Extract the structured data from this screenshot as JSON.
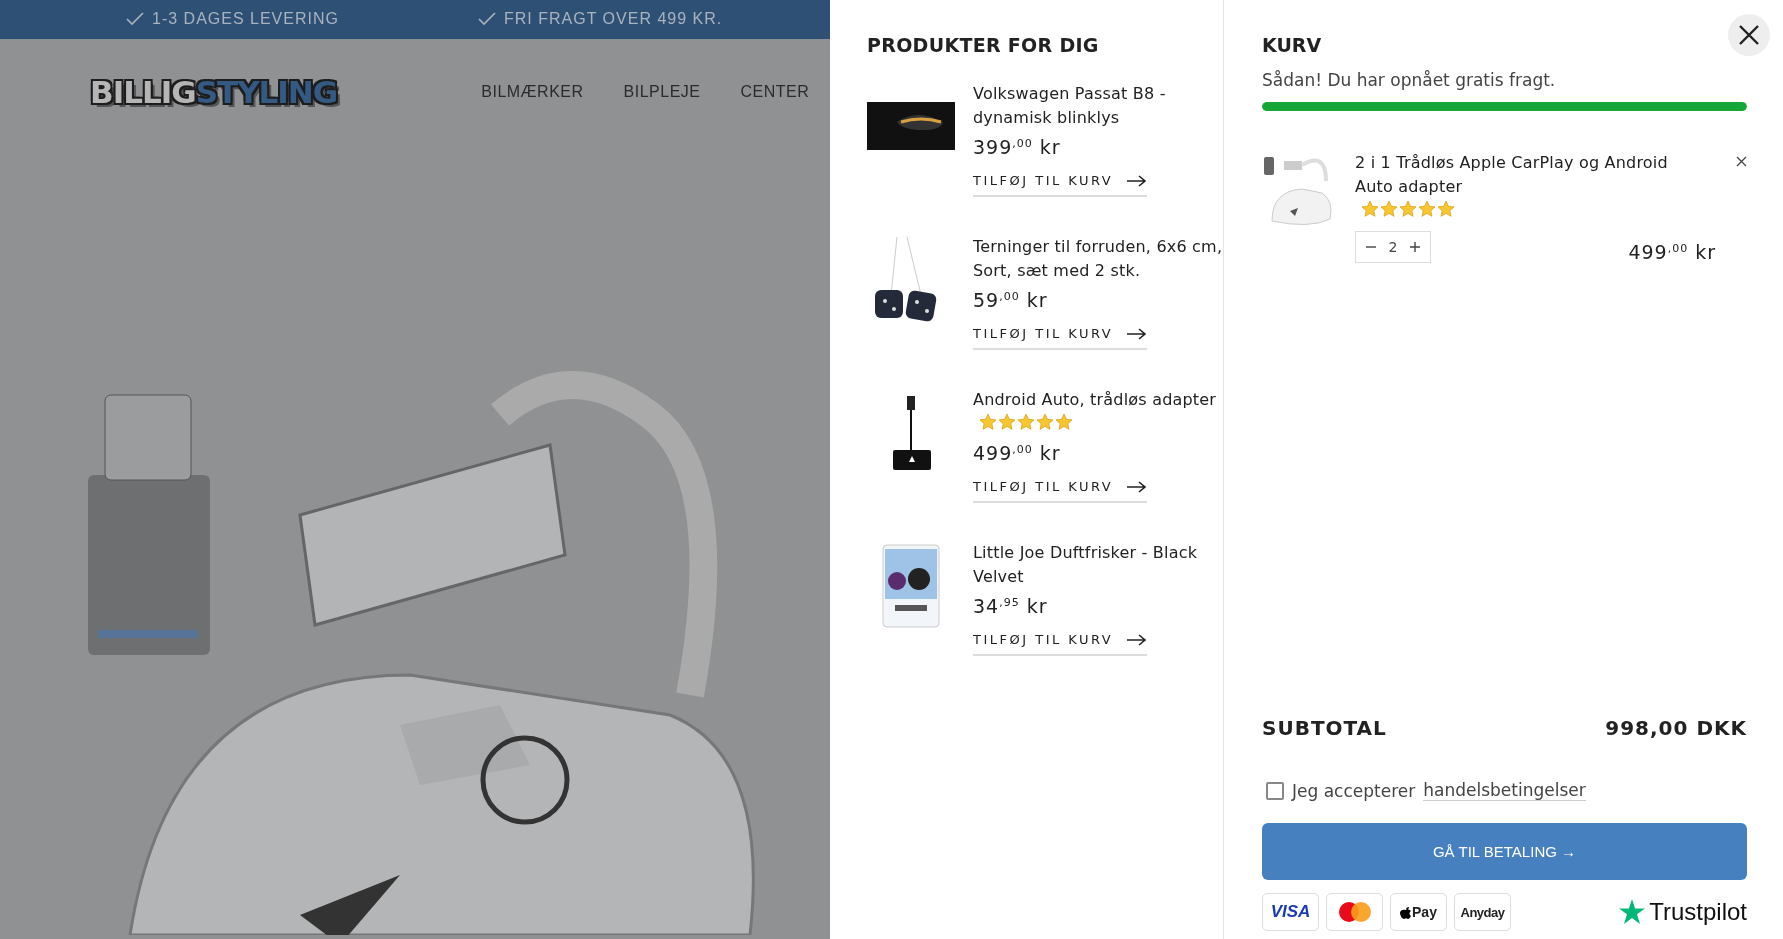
{
  "site": {
    "usp_bar": [
      "1-3 DAGES LEVERING",
      "FRI FRAGT OVER 499 KR."
    ],
    "logo": [
      "BILLIG",
      "STYLING"
    ],
    "nav": [
      "BILMÆRKER",
      "BILPLEJE",
      "CENTER"
    ]
  },
  "recommended": {
    "title": "PRODUKTER FOR DIG",
    "items": [
      {
        "name": "Volkswagen Passat B8 - dynamisk blinklys",
        "price": "399$^{,00}$ kr",
        "action": "TILFØJ TIL KURV"
      },
      {
        "name": "Terninger til forruden, 6x6 cm, Sort, sæt med 2 stk.",
        "price": "59$^{,00}$ kr",
        "action": "TILFØJ TIL KURV"
      },
      {
        "name": "Android Auto, trådløs adapter",
        "stars": 5,
        "price": "499$^{,00}$ kr",
        "action": "TILFØJ TIL KURV"
      },
      {
        "name": "Little Joe Duftfrisker - Black Velvet",
        "price": "34$^{,95}$ kr",
        "action": "TILFØJ TIL KURV"
      }
    ]
  },
  "cart": {
    "title": "KURV",
    "shipping_message": "Sådan! Du har opnået gratis fragt.",
    "shipping_progress": {
      "level": 1
    },
    "items": [
      {
        "name": "2 i 1 Trådløs Apple CarPlay og Android Auto adapter",
        "stars": 5,
        "quantity": "2",
        "price": "499$^{,00}$ kr"
      }
    ],
    "subtotal_label": "SUBTOTAL",
    "subtotal": "998,00 DKK",
    "terms": {
      "checked": false,
      "text": "Jeg accepterer",
      "link": "handelsbetingelser"
    },
    "checkout_button": "GÅ TIL BETALING →",
    "payment_methods": [
      {
        "kind": "visa",
        "label": "VISA"
      },
      {
        "kind": "mastercard"
      },
      {
        "kind": "applepay",
        "label": "Pay"
      },
      {
        "kind": "anyday",
        "label": "Anyday"
      }
    ],
    "trust_badge": "Trustpilot"
  }
}
